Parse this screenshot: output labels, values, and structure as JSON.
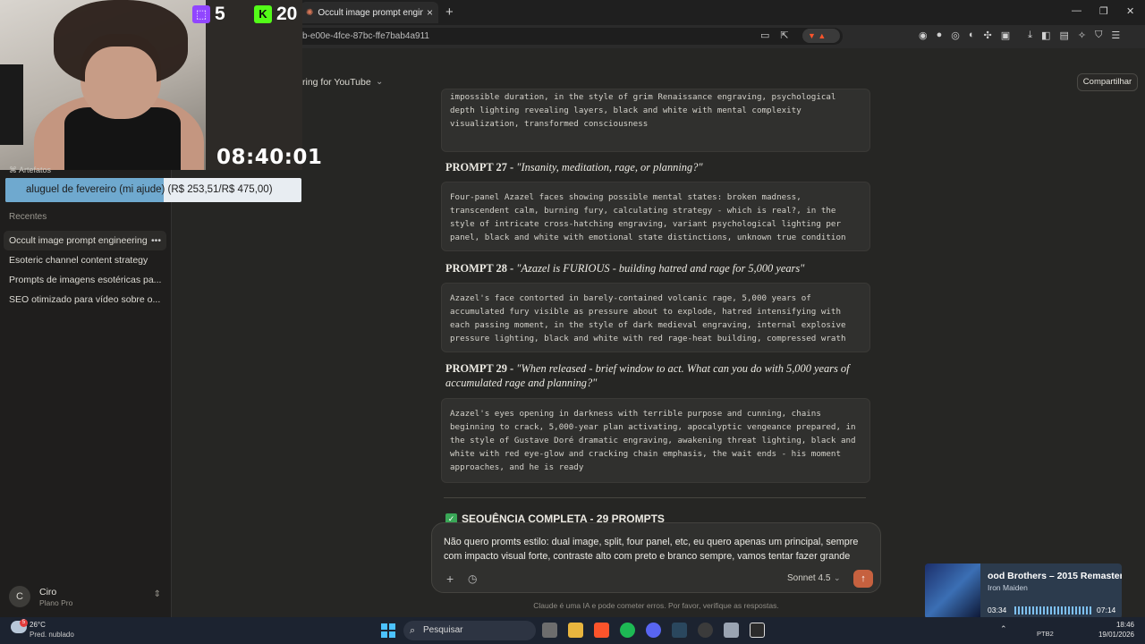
{
  "browser": {
    "tab_title": "Occult image prompt engineerin",
    "url_fragment": "b-e00e-4fce-87bc-ffe7bab4a911"
  },
  "header": {
    "project_title": "ring for YouTube",
    "share_label": "Compartilhar"
  },
  "sidebar": {
    "artifacts_label": "Artefatos",
    "recent_heading": "Recentes",
    "chats": [
      {
        "label": "Occult image prompt engineering"
      },
      {
        "label": "Esoteric channel content strategy"
      },
      {
        "label": "Prompts de imagens esotéricas pa..."
      },
      {
        "label": "SEO otimizado para vídeo sobre o..."
      }
    ],
    "user": {
      "initial": "C",
      "name": "Ciro",
      "plan": "Plano Pro"
    }
  },
  "content": {
    "block0": "impossible duration, in the style of grim Renaissance engraving, psychological\ndepth lighting revealing layers, black and white with mental complexity\nvisualization, transformed consciousness",
    "prompts": [
      {
        "label": "PROMPT 27 - ",
        "quote": "\"Insanity, meditation, rage, or planning?\"",
        "text": "Four-panel Azazel faces showing possible mental states: broken madness,\ntranscendent calm, burning fury, calculating strategy - which is real?, in the\nstyle of intricate cross-hatching engraving, variant psychological lighting per\npanel, black and white with emotional state distinctions, unknown true condition"
      },
      {
        "label": "PROMPT 28 - ",
        "quote": "\"Azazel is FURIOUS - building hatred and rage for 5,000 years\"",
        "text": "Azazel's face contorted in barely-contained volcanic rage, 5,000 years of\naccumulated fury visible as pressure about to explode, hatred intensifying with\neach passing moment, in the style of dark medieval engraving, internal explosive\npressure lighting, black and white with red rage-heat building, compressed wrath"
      },
      {
        "label": "PROMPT 29 - ",
        "quote": "\"When released - brief window to act. What can you do with 5,000 years of accumulated rage and planning?\"",
        "text": "Azazel's eyes opening in darkness with terrible purpose and cunning, chains\nbeginning to crack, 5,000-year plan activating, apocalyptic vengeance prepared, in\nthe style of Gustave Doré dramatic engraving, awakening threat lighting, black and\nwhite with red eye-glow and cracking chain emphasis, the wait ends - his moment\napproaches, and he is ready"
      }
    ],
    "sequence_heading": "SEQUÊNCIA COMPLETA - 29 PROMPTS"
  },
  "composer": {
    "text": "Não quero promts estilo: dual image, split, four panel, etc, eu quero apenas um principal, sempre com impacto visual forte, contraste alto com preto e branco sempre, vamos tentar fazer grande",
    "model": "Sonnet 4.5",
    "disclaimer": "Claude é uma IA e pode cometer erros. Por favor, verifique as respostas."
  },
  "overlay": {
    "twitch_count": "5",
    "kick_count": "20",
    "timer": "08:40:01",
    "goal_text": "aluguel de fevereiro (mi ajude) (R$ 253,51/R$ 475,00)",
    "goal_progress": 0.5337
  },
  "media": {
    "song": "ood Brothers – 2015 Remaster",
    "artist": "Iron Maiden",
    "elapsed": "03:34",
    "duration": "07:14"
  },
  "taskbar": {
    "temperature": "26°C",
    "weather": "Pred. nublado",
    "search_label": "Pesquisar",
    "lang": "PTB2",
    "time": "18:46",
    "date": "19/01/2026"
  },
  "colors": {
    "background": "#262624",
    "accent": "#c6613f",
    "twitch": "#9146ff",
    "kick": "#53fc18"
  }
}
